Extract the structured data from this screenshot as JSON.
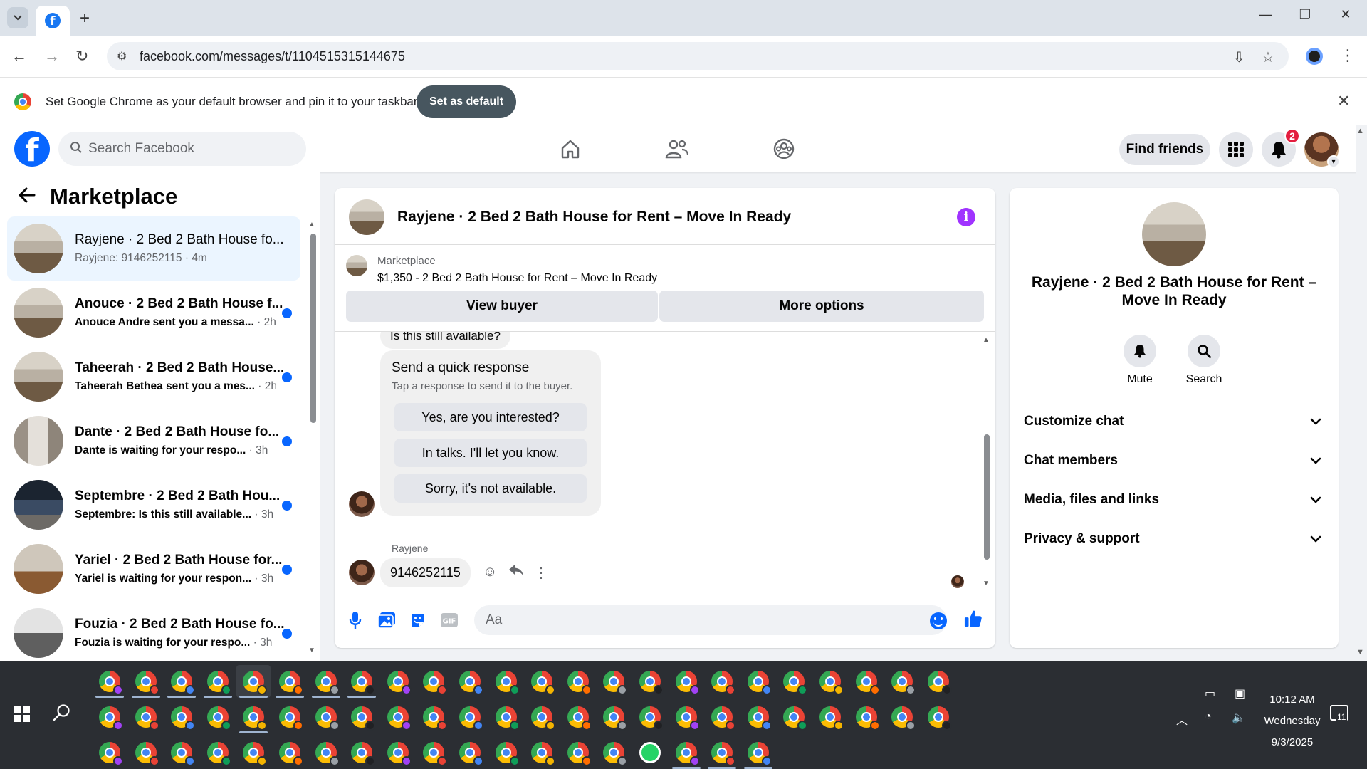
{
  "browser": {
    "url": "facebook.com/messages/t/1104515315144675",
    "infobar_text": "Set Google Chrome as your default browser and pin it to your taskbar",
    "set_default_label": "Set as default"
  },
  "fbnav": {
    "search_placeholder": "Search Facebook",
    "find_friends_label": "Find friends",
    "notification_count": "2"
  },
  "sidebar": {
    "title": "Marketplace",
    "conversations": [
      {
        "title": "Rayjene · 2 Bed 2 Bath House fo...",
        "preview": "Rayjene: 9146252115 · 4m",
        "time": "",
        "unread": false,
        "active": true
      },
      {
        "title": "Anouce · 2 Bed 2 Bath House f...",
        "preview": "Anouce Andre sent you a messa... ",
        "time": "· 2h",
        "unread": true
      },
      {
        "title": "Taheerah · 2 Bed 2 Bath House...",
        "preview": "Taheerah Bethea sent you a mes... ",
        "time": "· 2h",
        "unread": true
      },
      {
        "title": "Dante · 2 Bed 2 Bath House fo...",
        "preview": "Dante is waiting for your respo... ",
        "time": "· 3h",
        "unread": true
      },
      {
        "title": "Septembre · 2 Bed 2 Bath Hou...",
        "preview": "Septembre: Is this still available... ",
        "time": "· 3h",
        "unread": true
      },
      {
        "title": "Yariel · 2 Bed 2 Bath House for...",
        "preview": "Yariel is waiting for your respon... ",
        "time": "· 3h",
        "unread": true
      },
      {
        "title": "Fouzia · 2 Bed 2 Bath House fo...",
        "preview": "Fouzia is waiting for your respo... ",
        "time": "· 3h",
        "unread": true
      }
    ]
  },
  "chat": {
    "title": "Rayjene · 2 Bed 2 Bath House for Rent – Move In Ready",
    "listing_label": "Marketplace",
    "listing_desc": "$1,350 - 2 Bed 2 Bath House for Rent – Move In Ready",
    "view_buyer_label": "View buyer",
    "more_options_label": "More options",
    "prev_message": "Is this still available?",
    "quick_title": "Send a quick response",
    "quick_sub": "Tap a response to send it to the buyer.",
    "quick_responses": [
      "Yes, are you interested?",
      "In talks. I'll let you know.",
      "Sorry, it's not available."
    ],
    "sender_name": "Rayjene",
    "last_message": "9146252115",
    "composer_placeholder": "Aa"
  },
  "info_panel": {
    "title": "Rayjene · 2 Bed 2 Bath House for Rent – Move In Ready",
    "mute_label": "Mute",
    "search_label": "Search",
    "sections": [
      "Customize chat",
      "Chat members",
      "Media, files and links",
      "Privacy & support"
    ]
  },
  "taskbar": {
    "time": "10:12 AM",
    "day": "Wednesday",
    "date": "9/3/2025",
    "notification_count": "11"
  },
  "colors": {
    "accent": "#0866ff",
    "info_purple": "#a033ff",
    "unread_dot": "#0866ff",
    "badge_red": "#e41e3f"
  }
}
